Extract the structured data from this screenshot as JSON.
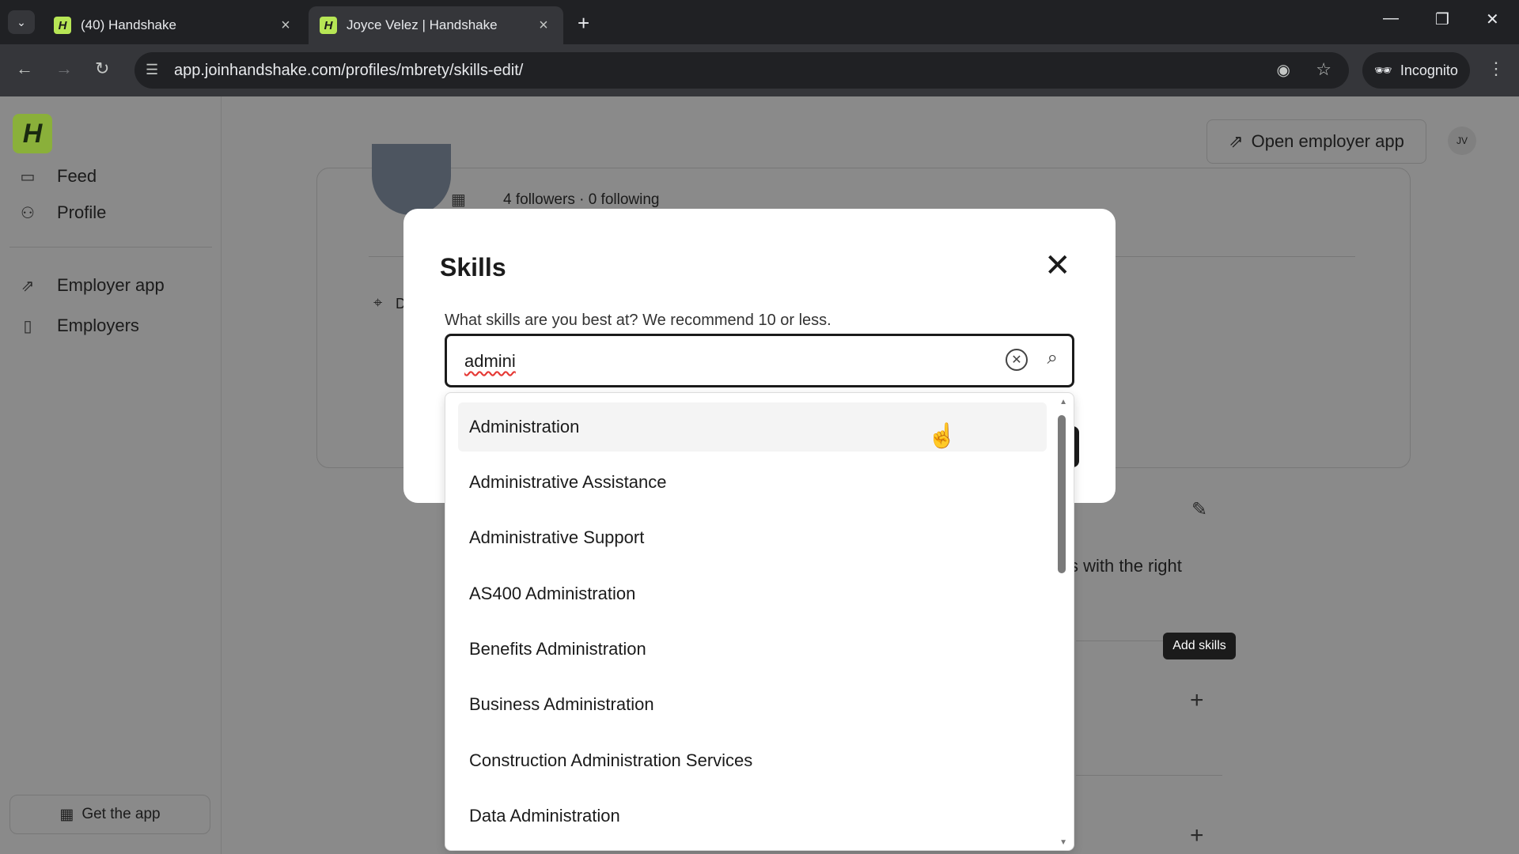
{
  "browser": {
    "tabs": [
      {
        "label": "(40) Handshake",
        "favicon": "H"
      },
      {
        "label": "Joyce Velez | Handshake",
        "favicon": "H"
      }
    ],
    "url": "app.joinhandshake.com/profiles/mbrety/skills-edit/",
    "incognito_label": "Incognito"
  },
  "sidebar": {
    "logo": "H",
    "items": [
      {
        "label": "Feed",
        "icon": "feed-icon"
      },
      {
        "label": "Profile",
        "icon": "person-icon"
      },
      {
        "label": "Employer app",
        "icon": "external-link-icon"
      },
      {
        "label": "Employers",
        "icon": "building-badge-icon"
      }
    ],
    "get_app_label": "Get the app"
  },
  "header": {
    "open_employer_app": "Open employer app",
    "avatar_initials": "JV"
  },
  "profile": {
    "followers": "4 followers · 0 following",
    "location_partial": "D",
    "partial_text": "s with the right",
    "tooltip": "Add skills"
  },
  "modal": {
    "title": "Skills",
    "description": "What skills are you best at? We recommend 10 or less.",
    "search_value": "admini"
  },
  "dropdown": {
    "options": [
      "Administration",
      "Administrative Assistance",
      "Administrative Support",
      "AS400 Administration",
      "Benefits Administration",
      "Business Administration",
      "Construction Administration Services",
      "Data Administration"
    ],
    "hovered_index": 0
  }
}
